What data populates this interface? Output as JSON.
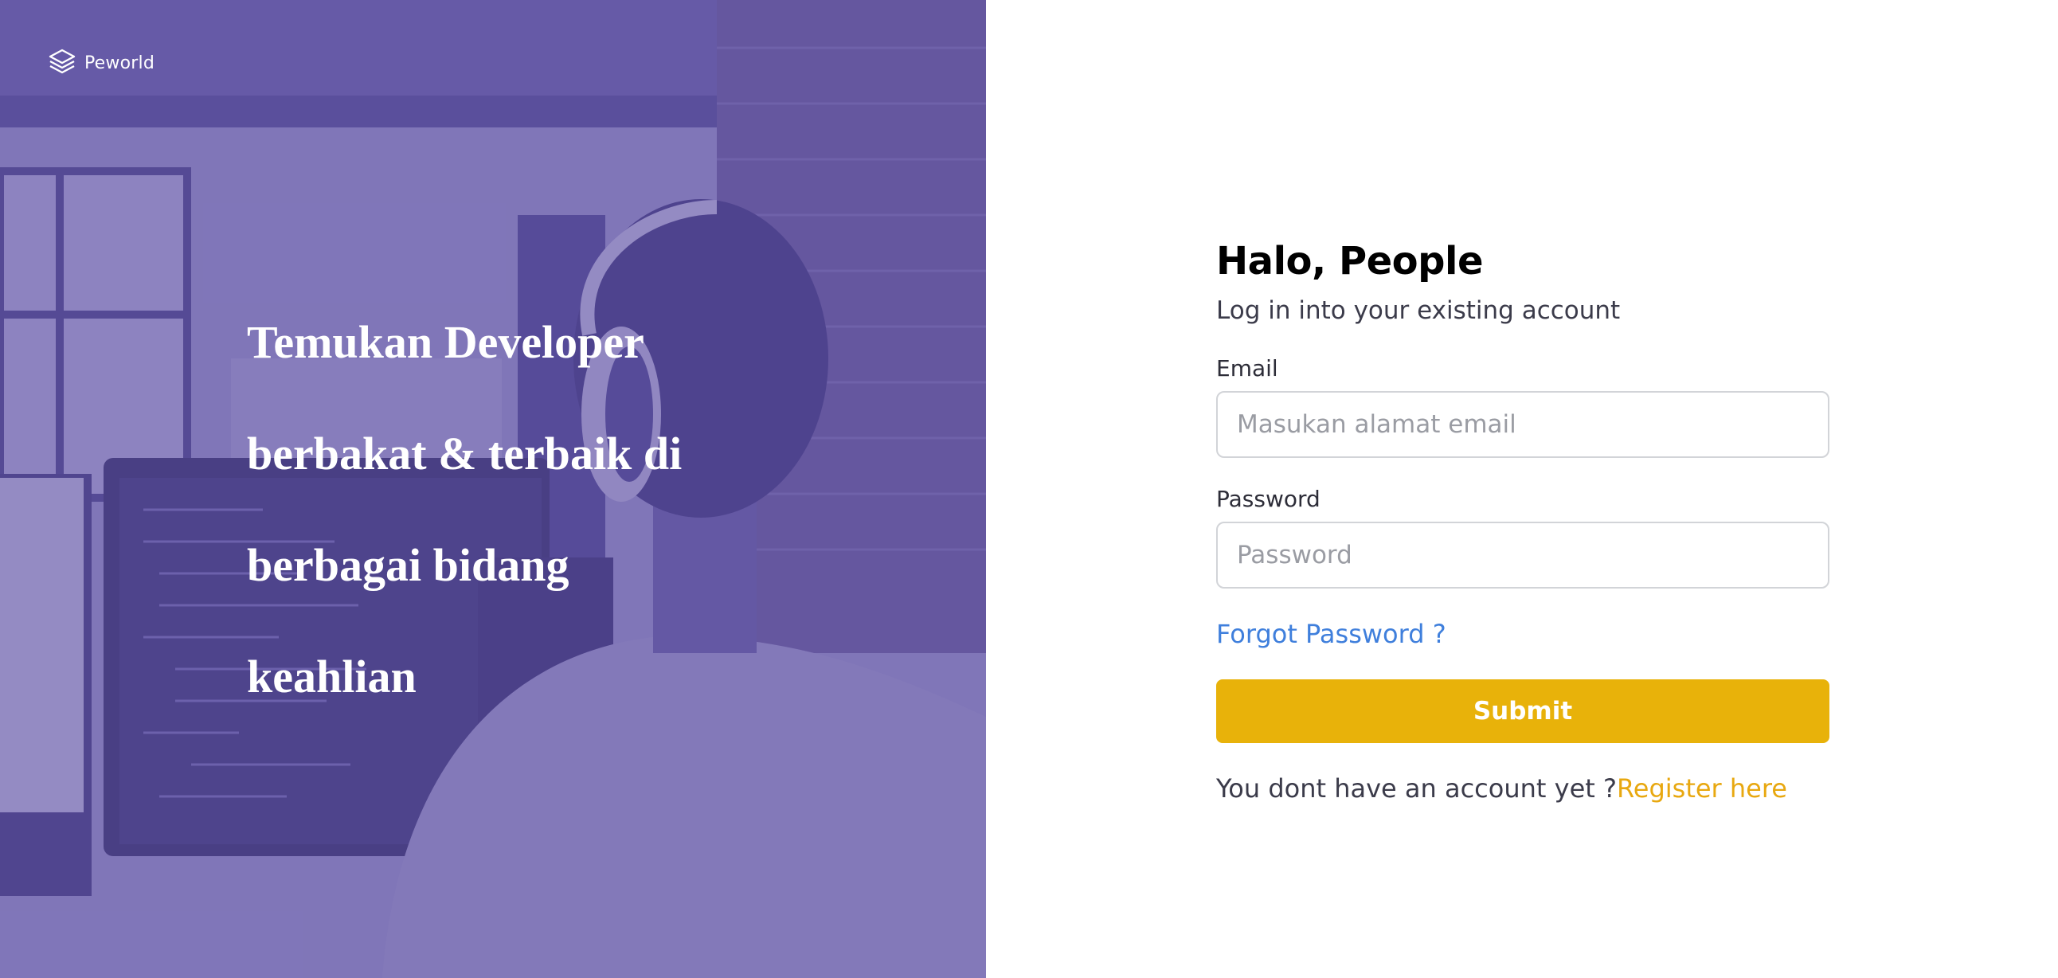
{
  "brand": {
    "logo_icon": "layers-icon",
    "name": "Peworld"
  },
  "hero": {
    "headline_lines": [
      "Temukan Developer",
      "berbakat & terbaik di",
      "berbagai bidang",
      "keahlian"
    ],
    "overlay_color": "#5e50a1"
  },
  "login": {
    "title": "Halo, People",
    "subtitle": "Log in into your existing account",
    "email": {
      "label": "Email",
      "placeholder": "Masukan alamat email",
      "value": ""
    },
    "password": {
      "label": "Password",
      "placeholder": "Password",
      "value": ""
    },
    "forgot_label": "Forgot Password ?",
    "submit_label": "Submit",
    "register_prompt": "You dont have an account yet ?",
    "register_link": "Register here"
  },
  "colors": {
    "accent": "#e8b20a",
    "link": "#3f7fdc",
    "register_link": "#e8a810"
  }
}
